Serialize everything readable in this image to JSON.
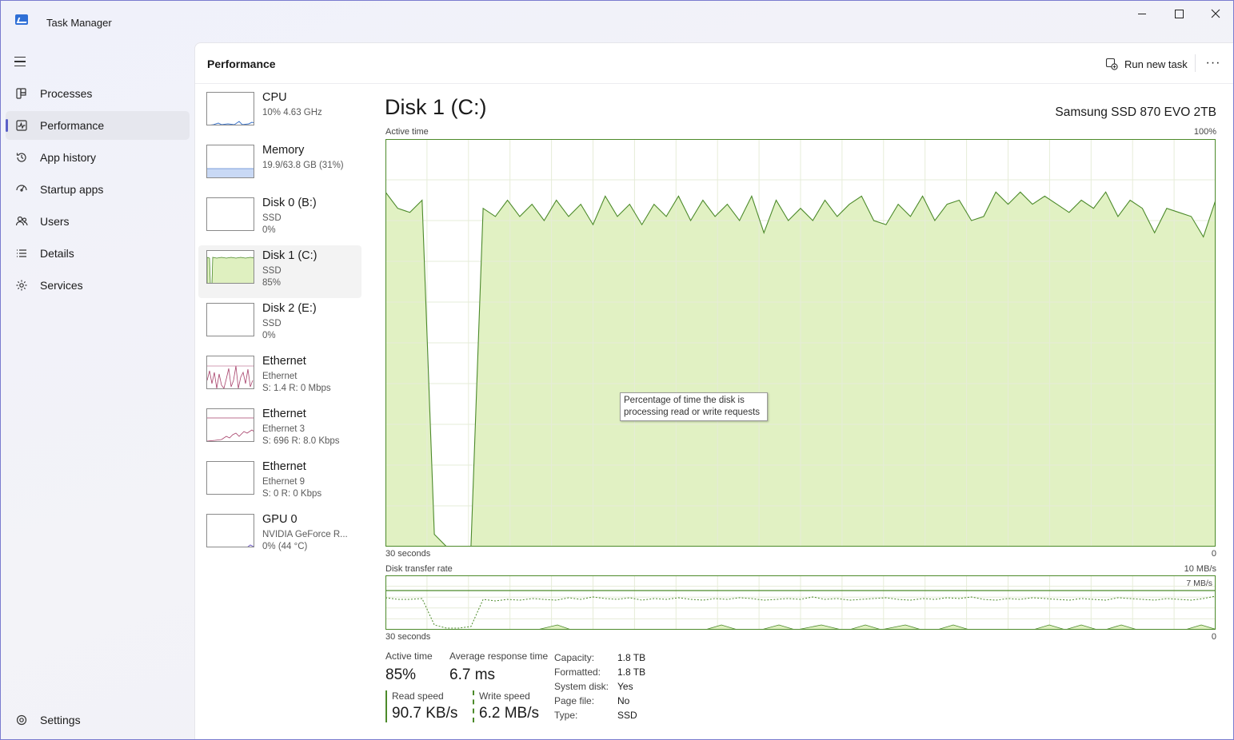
{
  "app": {
    "title": "Task Manager"
  },
  "nav": {
    "items": [
      {
        "label": "Processes",
        "icon": "processes-icon"
      },
      {
        "label": "Performance",
        "icon": "performance-icon",
        "active": true
      },
      {
        "label": "App history",
        "icon": "history-icon"
      },
      {
        "label": "Startup apps",
        "icon": "startup-icon"
      },
      {
        "label": "Users",
        "icon": "users-icon"
      },
      {
        "label": "Details",
        "icon": "details-icon"
      },
      {
        "label": "Services",
        "icon": "services-icon"
      }
    ],
    "settings": "Settings"
  },
  "header": {
    "title": "Performance",
    "run_new_task": "Run new task",
    "more": "···"
  },
  "devices": [
    {
      "name": "CPU",
      "sub1": "10%  4.63 GHz",
      "sub2": "",
      "kind": "cpu"
    },
    {
      "name": "Memory",
      "sub1": "19.9/63.8 GB (31%)",
      "sub2": "",
      "kind": "mem"
    },
    {
      "name": "Disk 0 (B:)",
      "sub1": "SSD",
      "sub2": "0%",
      "kind": "disk0"
    },
    {
      "name": "Disk 1 (C:)",
      "sub1": "SSD",
      "sub2": "85%",
      "kind": "disk1",
      "active": true
    },
    {
      "name": "Disk 2 (E:)",
      "sub1": "SSD",
      "sub2": "0%",
      "kind": "disk2"
    },
    {
      "name": "Ethernet",
      "sub1": "Ethernet",
      "sub2": "S: 1.4  R: 0 Mbps",
      "kind": "eth1"
    },
    {
      "name": "Ethernet",
      "sub1": "Ethernet 3",
      "sub2": "S: 696  R: 8.0 Kbps",
      "kind": "eth2"
    },
    {
      "name": "Ethernet",
      "sub1": "Ethernet 9",
      "sub2": "S: 0  R: 0 Kbps",
      "kind": "eth3"
    },
    {
      "name": "GPU 0",
      "sub1": "NVIDIA GeForce R...",
      "sub2": "0%  (44 °C)",
      "kind": "gpu"
    }
  ],
  "detail": {
    "title": "Disk 1 (C:)",
    "model": "Samsung SSD 870 EVO 2TB",
    "active_time_label": "Active time",
    "active_time_max": "100%",
    "axis_left": "30 seconds",
    "axis_right": "0",
    "transfer_label": "Disk transfer rate",
    "transfer_max": "10 MB/s",
    "transfer_scale": "7 MB/s",
    "axis2_left": "30 seconds",
    "axis2_right": "0",
    "tooltip": "Percentage of time the disk is processing read or write requests"
  },
  "stats": {
    "active_time": {
      "label": "Active time",
      "value": "85%"
    },
    "avg_response": {
      "label": "Average response time",
      "value": "6.7 ms"
    },
    "read_speed": {
      "label": "Read speed",
      "value": "90.7 KB/s"
    },
    "write_speed": {
      "label": "Write speed",
      "value": "6.2 MB/s"
    }
  },
  "properties": [
    {
      "k": "Capacity:",
      "v": "1.8 TB"
    },
    {
      "k": "Formatted:",
      "v": "1.8 TB"
    },
    {
      "k": "System disk:",
      "v": "Yes"
    },
    {
      "k": "Page file:",
      "v": "No"
    },
    {
      "k": "Type:",
      "v": "SSD"
    }
  ],
  "colors": {
    "accent": "#5b5fc7",
    "disk_line": "#4c8a2a",
    "disk_fill": "#dff0c0",
    "net_line": "#a7416a",
    "mem_fill": "#c9d9f5",
    "mem_line": "#7d9fdc"
  },
  "chart_data": {
    "type": "area",
    "title": "Active time",
    "ylim": [
      0,
      100
    ],
    "x_range_seconds": [
      30,
      0
    ],
    "series": [
      {
        "values": [
          87,
          83,
          82,
          85,
          3,
          0,
          -0.5,
          0,
          83,
          81,
          85,
          81,
          84,
          80,
          85,
          81,
          84,
          79,
          86,
          81,
          84,
          79,
          84,
          81,
          86,
          80,
          85,
          81,
          84,
          80,
          86,
          77,
          85,
          80,
          83,
          80,
          85,
          81,
          84,
          86,
          80,
          79,
          84,
          81,
          86,
          80,
          84,
          85,
          80,
          81,
          87,
          84,
          87,
          84,
          86,
          84,
          82,
          85,
          83,
          87,
          81,
          85,
          83,
          77,
          83,
          82,
          81,
          76,
          85
        ]
      }
    ]
  }
}
